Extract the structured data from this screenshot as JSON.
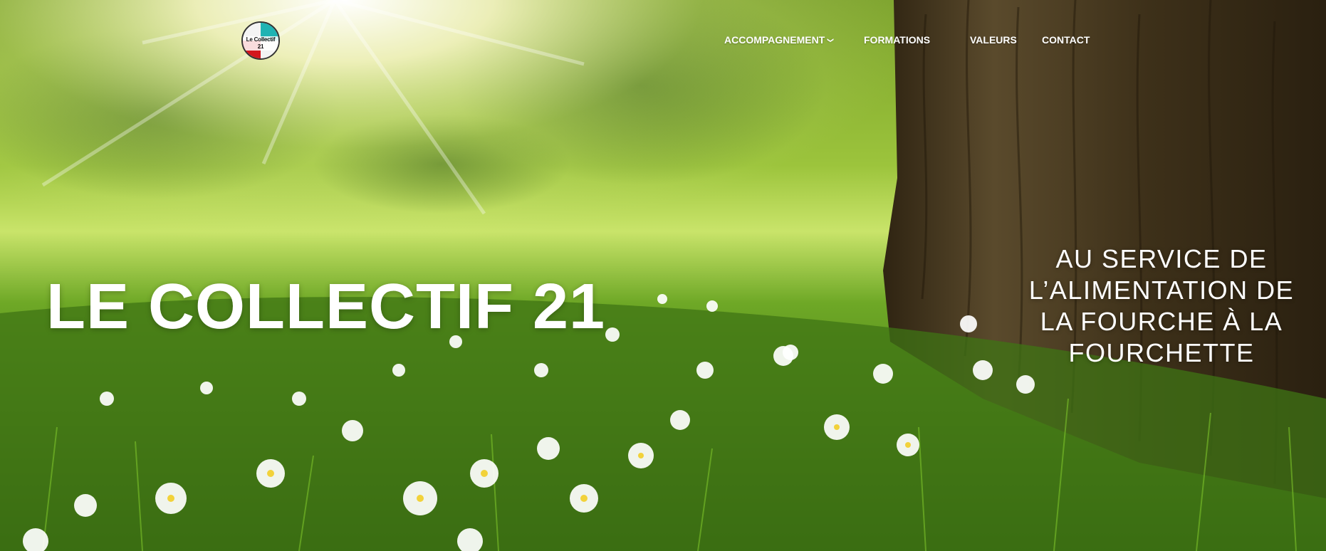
{
  "header": {
    "logo_text": "Le Collectif 21",
    "nav": [
      {
        "label": "ACCOMPAGNEMENT",
        "has_dropdown": true
      },
      {
        "label": "FORMATIONS",
        "has_dropdown": true
      },
      {
        "label": "VALEURS",
        "has_dropdown": false
      },
      {
        "label": "CONTACT",
        "has_dropdown": false
      }
    ]
  },
  "hero": {
    "title": "LE COLLECTIF 21",
    "subtitle": "AU SERVICE DE L’ALIMENTATION DE LA FOURCHE À LA FOURCHETTE"
  },
  "colors": {
    "nav_text": "#ffffff",
    "logo_teal": "#1fb3b3",
    "logo_red": "#d3161d",
    "grass_dark": "#3c6a12",
    "grass_light": "#8cc43a",
    "bark": "#4a3a24"
  }
}
